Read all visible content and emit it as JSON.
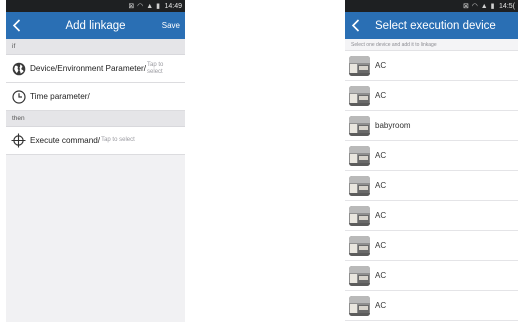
{
  "left_screen": {
    "status_time": "14:49",
    "status_icons": "⊠ ◠ ▲ ▮",
    "title": "Add linkage",
    "save_label": "Save",
    "if_label": "if",
    "then_label": "then",
    "rows": {
      "device": {
        "label": "Device/Environment Parameter/",
        "hint_line1": "Tap to",
        "hint_line2": "select",
        "icon": "globe-icon"
      },
      "time": {
        "label": "Time parameter/",
        "icon": "clock-icon"
      },
      "execute": {
        "label": "Execute command/",
        "hint": "Tap to select",
        "icon": "crosshair-icon"
      }
    }
  },
  "right_screen": {
    "status_time": "14:5(",
    "status_icons": "⊠ ◠ ▲ ▮",
    "title": "Select execution device",
    "hint": "Select one device and add it to linkage",
    "devices": [
      {
        "name": "AC"
      },
      {
        "name": "AC"
      },
      {
        "name": "babyroom"
      },
      {
        "name": "AC"
      },
      {
        "name": "AC"
      },
      {
        "name": "AC"
      },
      {
        "name": "AC"
      },
      {
        "name": "AC"
      },
      {
        "name": "AC"
      }
    ]
  },
  "colors": {
    "appbar": "#2a6fb4",
    "statusbar": "#1e2022",
    "left_bg": "#f1f1f3"
  }
}
